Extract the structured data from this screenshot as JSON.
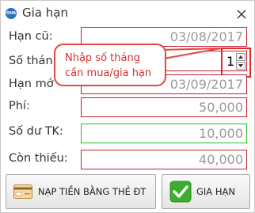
{
  "window": {
    "title": "Gia hạn",
    "app_icon_text": "OHA"
  },
  "form": {
    "expiry_old": {
      "label": "Hạn cũ:",
      "value": "03/08/2017"
    },
    "months": {
      "label": "Số thán",
      "value": "1"
    },
    "expiry_new": {
      "label": "Hạn mớ",
      "value": "03/09/2017"
    },
    "fee": {
      "label": "Phí:",
      "value": "50,000"
    },
    "balance": {
      "label": "Số dư TK:",
      "value": "10,000"
    },
    "shortfall": {
      "label": "Còn thiếu:",
      "value": "40,000"
    }
  },
  "tooltip": {
    "line1": "Nhập số tháng",
    "line2": "cần mua/gia hạn"
  },
  "buttons": {
    "topup_label": "NẠP TIỀN BẰNG THẺ ĐT",
    "extend_label": "GIA HẠN"
  },
  "colors": {
    "field_border": "#c4202f",
    "balance_border": "#2eb82e",
    "tooltip_border": "#e64545",
    "tooltip_text": "#d43030",
    "check_green": "#3cae2e"
  },
  "icons": {
    "app": "app-logo-icon",
    "close": "close-icon",
    "spin_up": "chevron-up-icon",
    "spin_down": "chevron-down-icon",
    "topup": "credit-card-icon",
    "extend": "checkmark-icon"
  }
}
